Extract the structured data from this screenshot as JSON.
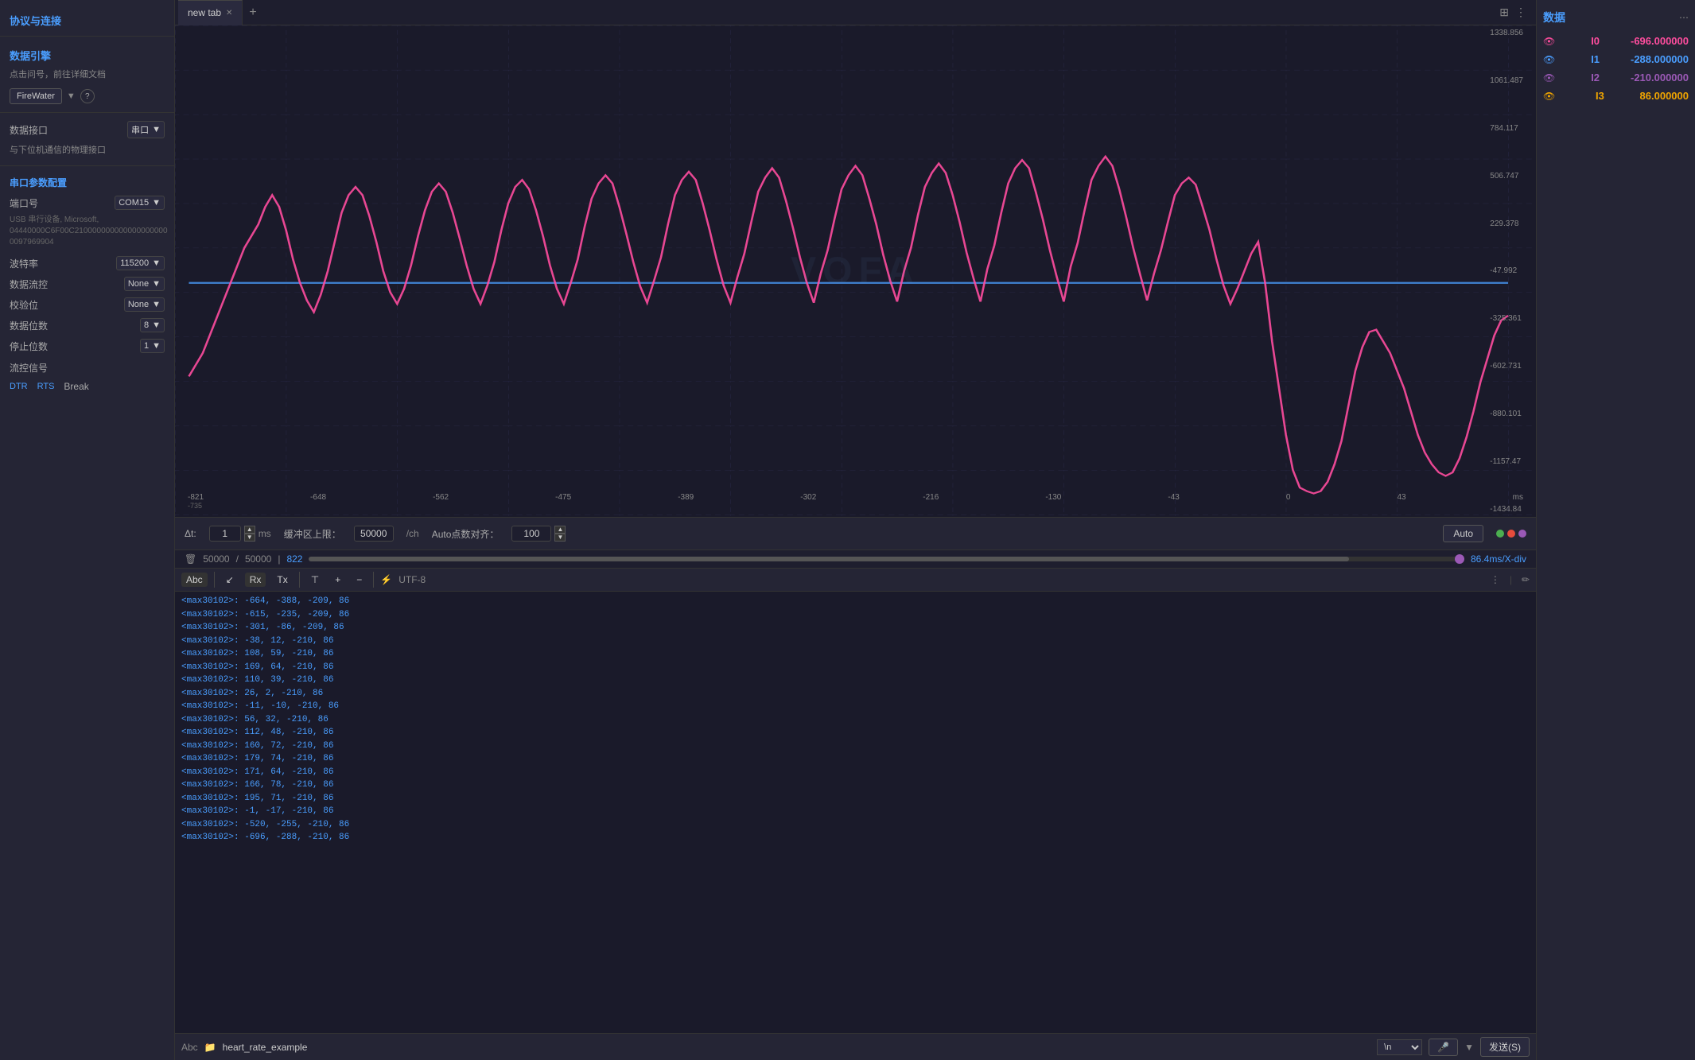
{
  "sidebar": {
    "section1_title": "协议与连接",
    "section2_title": "数据引擎",
    "section2_subtitle": "点击问号，前往详细文档",
    "firewater_label": "FireWater",
    "question_label": "?",
    "section3_title": "数据接口",
    "section3_subtitle": "与下位机通信的物理接口",
    "interface_label": "串口",
    "serial_config_title": "串口参数配置",
    "port_label": "端口号",
    "port_value": "COM15",
    "serial_info": "USB 串行设备, Microsoft, 04440000C6F00C210000000000000000000 0097969904",
    "baud_label": "波特率",
    "baud_value": "115200",
    "flow_label": "数据流控",
    "flow_value": "None",
    "parity_label": "校验位",
    "parity_value": "None",
    "data_bits_label": "数据位数",
    "data_bits_value": "8",
    "stop_bits_label": "停止位数",
    "stop_bits_value": "1",
    "flow_ctrl_label": "流控信号",
    "dtr_label": "DTR",
    "rts_label": "RTS",
    "break_label": "Break"
  },
  "tabs": {
    "tab1_label": "new tab",
    "add_label": "+"
  },
  "chart": {
    "watermark": "VOFA",
    "y_labels": [
      "1338.856",
      "1061.487",
      "784.117",
      "506.747",
      "229.378",
      "-47.992",
      "-325.361",
      "-602.731",
      "-880.101",
      "-1157.47",
      "-1434.84"
    ],
    "x_labels": [
      "-821",
      "-735",
      "-648",
      "-562",
      "-475",
      "-389",
      "-302",
      "-216",
      "-130",
      "-43",
      "0",
      "43"
    ],
    "x_unit": "ms"
  },
  "controls": {
    "delta_t_label": "Δt:",
    "delta_t_value": "1",
    "delta_t_unit": "ms",
    "buffer_label": "缓冲区上限：",
    "buffer_value": "50000",
    "buffer_unit": "/ch",
    "auto_points_label": "Auto点数对齐：",
    "auto_points_value": "100",
    "auto_btn_label": "Auto"
  },
  "progress": {
    "trash_icon": "🗑",
    "count1": "50000",
    "slash": "/",
    "count2": "50000",
    "pipe": "|",
    "samples": "822",
    "rate": "86.4ms/X-div"
  },
  "serial_monitor": {
    "btn_abc": "Abc",
    "btn_wave": "↙",
    "btn_rx": "Rx",
    "btn_tx": "Tx",
    "btn_align": "⊤",
    "btn_plus": "+",
    "btn_minus": "−",
    "encoding": "UTF-8",
    "lines": [
      "<max30102>: -664, -388, -209, 86",
      "<max30102>: -615, -235, -209, 86",
      "<max30102>: -301, -86, -209, 86",
      "<max30102>: -38, 12, -210, 86",
      "<max30102>: 108, 59, -210, 86",
      "<max30102>: 169, 64, -210, 86",
      "<max30102>: 110, 39, -210, 86",
      "<max30102>: 26, 2, -210, 86",
      "<max30102>: -11, -10, -210, 86",
      "<max30102>: 56, 32, -210, 86",
      "<max30102>: 112, 48, -210, 86",
      "<max30102>: 160, 72, -210, 86",
      "<max30102>: 179, 74, -210, 86",
      "<max30102>: 171, 64, -210, 86",
      "<max30102>: 166, 78, -210, 86",
      "<max30102>: 195, 71, -210, 86",
      "<max30102>: -1, -17, -210, 86",
      "<max30102>: -520, -255, -210, 86",
      "<max30102>: -696, -288, -210, 86"
    ],
    "input_placeholder": "heart_rate_example",
    "newline_option": "\\n",
    "send_btn": "发送(S)"
  },
  "right_panel": {
    "title": "数据",
    "channels": [
      {
        "id": "I0",
        "value": "-696.000000",
        "color": "#ff4d9e"
      },
      {
        "id": "I1",
        "value": "-288.000000",
        "color": "#4a9eff"
      },
      {
        "id": "I2",
        "value": "-210.000000",
        "color": "#9b59b6"
      },
      {
        "id": "I3",
        "value": "86.000000",
        "color": "#f0a500"
      }
    ]
  },
  "colors": {
    "dot1": "#4CAF50",
    "dot2": "#e74c3c",
    "dot3": "#9b59b6",
    "accent": "#4a9eff",
    "pink": "#ff4d9e",
    "blue_line": "#4a9eff"
  }
}
